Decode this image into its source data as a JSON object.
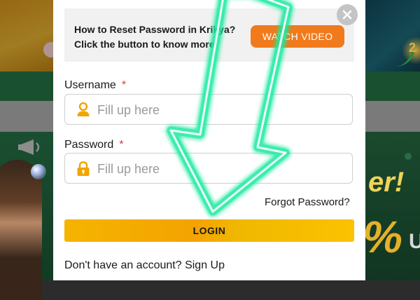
{
  "colors": {
    "accent_orange": "#f07a1c",
    "login_yellow": "#f5b400",
    "required_red": "#e23b3b",
    "icon_yellow": "#f0a500",
    "arrow_neon_green": "#1de9a0"
  },
  "video_banner": {
    "line1": "How to Reset Password in Krikya?",
    "line2": "Click the button to know more",
    "button_label": "WATCH VIDEO"
  },
  "form": {
    "username_label": "Username",
    "username_placeholder": "Fill up here",
    "password_label": "Password",
    "password_placeholder": "Fill up here",
    "required_mark": "*",
    "forgot_label": "Forgot Password?",
    "login_label": "LOGIN",
    "signup_prompt": "Don't have an account?",
    "signup_link": "Sign Up"
  },
  "icons": {
    "close": "close-icon",
    "username": "user-icon",
    "password": "lock-icon",
    "overlay": "arrow-down-icon"
  },
  "background": {
    "promo_right_text": "er!",
    "promo_right_pct": "%",
    "promo_right_tail": "Up",
    "promo_top_right_text": "2"
  }
}
